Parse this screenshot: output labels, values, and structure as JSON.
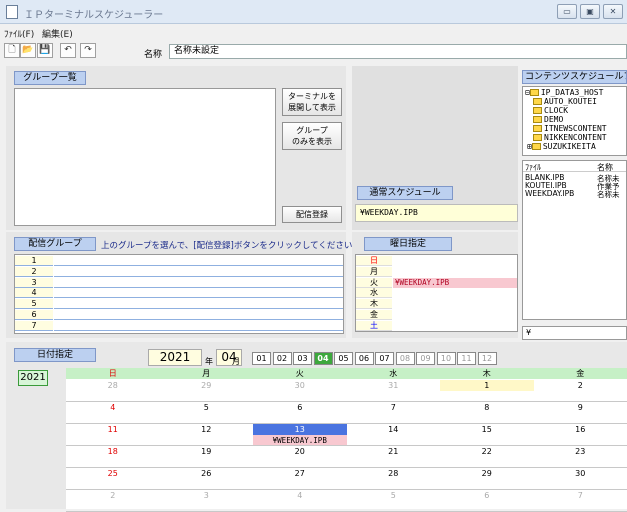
{
  "window": {
    "title": "ＩＰターミナルスケジューラー",
    "buttons": [
      "▭",
      "▣",
      "✕"
    ]
  },
  "menu": [
    "ﾌｧｲﾙ(F)",
    "編集(E)"
  ],
  "toolbar": {
    "icons": [
      "new-file-icon",
      "open-folder-icon",
      "save-icon",
      "undo-icon",
      "redo-icon"
    ],
    "glyphs": [
      "🗋",
      "📂",
      "💾",
      "↶",
      "↷"
    ],
    "name_label": "名称",
    "name_value": "名称未設定"
  },
  "group_panel": {
    "header": "グループ一覧",
    "expand_terminal_button": "ターミナルを\n展開して表示",
    "group_only_button": "グループ\nのみを表示",
    "register_button": "配信登録"
  },
  "normal_schedule": {
    "header": "通常スケジュール",
    "value": "¥WEEKDAY.IPB"
  },
  "content_schedule": {
    "header": "コンテンツスケジュールファ",
    "tree": [
      {
        "indent": 0,
        "prefix": "⊟",
        "label": "IP_DATA3_HOST"
      },
      {
        "indent": 1,
        "prefix": "",
        "label": "AUTO_KOUTEI"
      },
      {
        "indent": 1,
        "prefix": "",
        "label": "CLOCK"
      },
      {
        "indent": 1,
        "prefix": "",
        "label": "DEMO"
      },
      {
        "indent": 1,
        "prefix": "",
        "label": "ITNEWSCONTENT"
      },
      {
        "indent": 1,
        "prefix": "",
        "label": "NIKKENCONTENT"
      },
      {
        "indent": 1,
        "prefix": "⊞",
        "label": "SUZUKIKEITA"
      }
    ],
    "file_columns": [
      "ﾌｧｲﾙ",
      "名称"
    ],
    "files": [
      [
        "BLANK.IPB",
        "名称未"
      ],
      [
        "KOUTEI.IPB",
        "作業予"
      ],
      [
        "WEEKDAY.IPB",
        "名称未"
      ]
    ],
    "path": "¥"
  },
  "delivery_group": {
    "header": "配信グループ",
    "instruction": "上のグループを選んで、[配信登録]ボタンをクリックしてください。",
    "rows": [
      "1",
      "2",
      "3",
      "4",
      "5",
      "6",
      "7"
    ]
  },
  "weekday": {
    "header": "曜日指定",
    "days": [
      "日",
      "月",
      "火",
      "水",
      "木",
      "金",
      "土"
    ],
    "values": [
      "",
      "",
      "¥WEEKDAY.IPB",
      "",
      "",
      "",
      ""
    ],
    "day_colors": [
      "#ff0000",
      "#000000",
      "#000000",
      "#000000",
      "#000000",
      "#000000",
      "#0000ff"
    ]
  },
  "date_section": {
    "header": "日付指定",
    "year": "2021",
    "year_unit": "年",
    "month": "04",
    "month_unit": "月",
    "month_tabs": [
      "01",
      "02",
      "03",
      "04",
      "05",
      "06",
      "07",
      "08",
      "09",
      "10",
      "11",
      "12"
    ],
    "active_month": "04",
    "year_button": "2021",
    "columns": [
      "日",
      "月",
      "火",
      "水",
      "木",
      "金"
    ],
    "weeks": [
      [
        "28",
        "29",
        "30",
        "31",
        "1",
        "2"
      ],
      [
        "4",
        "5",
        "6",
        "7",
        "8",
        "9"
      ],
      [
        "11",
        "12",
        "13",
        "14",
        "15",
        "16"
      ],
      [
        "18",
        "19",
        "20",
        "21",
        "22",
        "23"
      ],
      [
        "25",
        "26",
        "27",
        "28",
        "29",
        "30"
      ],
      [
        "2",
        "3",
        "4",
        "5",
        "6",
        "7"
      ]
    ],
    "selected_day": "13",
    "selected_note": "¥WEEKDAY.IPB"
  },
  "colors": {
    "accent_header": "#bcd0f0",
    "calendar_header": "#c6f0c6",
    "weekday_highlight": "#f8c8d0",
    "selected_day": "#4a74e0"
  }
}
